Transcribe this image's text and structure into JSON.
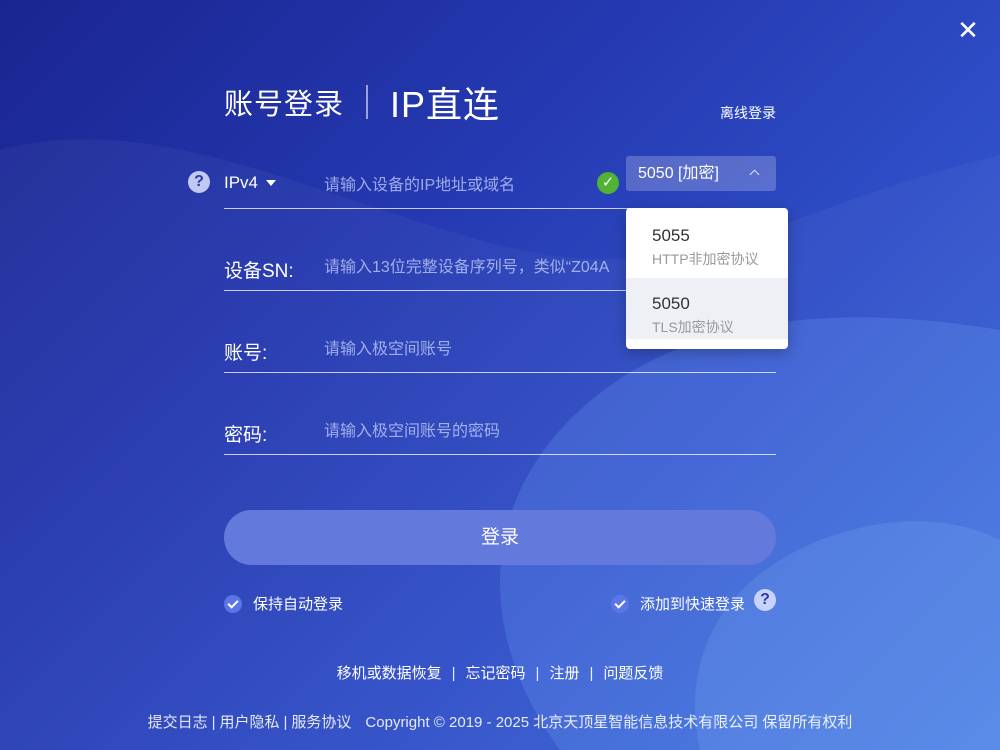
{
  "window": {
    "close_glyph": "✕"
  },
  "tabs": {
    "account": "账号登录",
    "ip_direct": "IP直连"
  },
  "offline_login": "离线登录",
  "ip_row": {
    "help_glyph": "?",
    "ip_version": "IPv4",
    "ip_placeholder": "请输入设备的IP地址或域名",
    "ok_glyph": "✓",
    "port_selected": "5050 [加密]"
  },
  "port_dropdown": {
    "options": [
      {
        "port": "5055",
        "desc": "HTTP非加密协议"
      },
      {
        "port": "5050",
        "desc": "TLS加密协议"
      }
    ]
  },
  "sn_row": {
    "label": "设备SN:",
    "placeholder": "请输入13位完整设备序列号，类似“Z04A"
  },
  "account_row": {
    "label": "账号:",
    "placeholder": "请输入极空间账号"
  },
  "password_row": {
    "label": "密码:",
    "placeholder": "请输入极空间账号的密码"
  },
  "login_button": "登录",
  "keep_login": "保持自动登录",
  "add_quick_login": "添加到快速登录",
  "quick_help_glyph": "?",
  "links": {
    "migrate": "移机或数据恢复",
    "forgot": "忘记密码",
    "register": "注册",
    "feedback": "问题反馈"
  },
  "footer": {
    "log": "提交日志",
    "privacy": "用户隐私",
    "service": "服务协议",
    "copyright": "Copyright © 2019 - 2025 北京天顶星智能信息技术有限公司 保留所有权利"
  },
  "colors": {
    "accent": "#6479dc",
    "ok_green": "#52b233",
    "bg_dark": "#1a2590",
    "bg_light": "#3f72dc"
  },
  "icons": [
    "close-icon",
    "help-icon",
    "caret-down-icon",
    "check-circle-icon",
    "chevron-up-icon",
    "checkbox-checked-icon"
  ]
}
